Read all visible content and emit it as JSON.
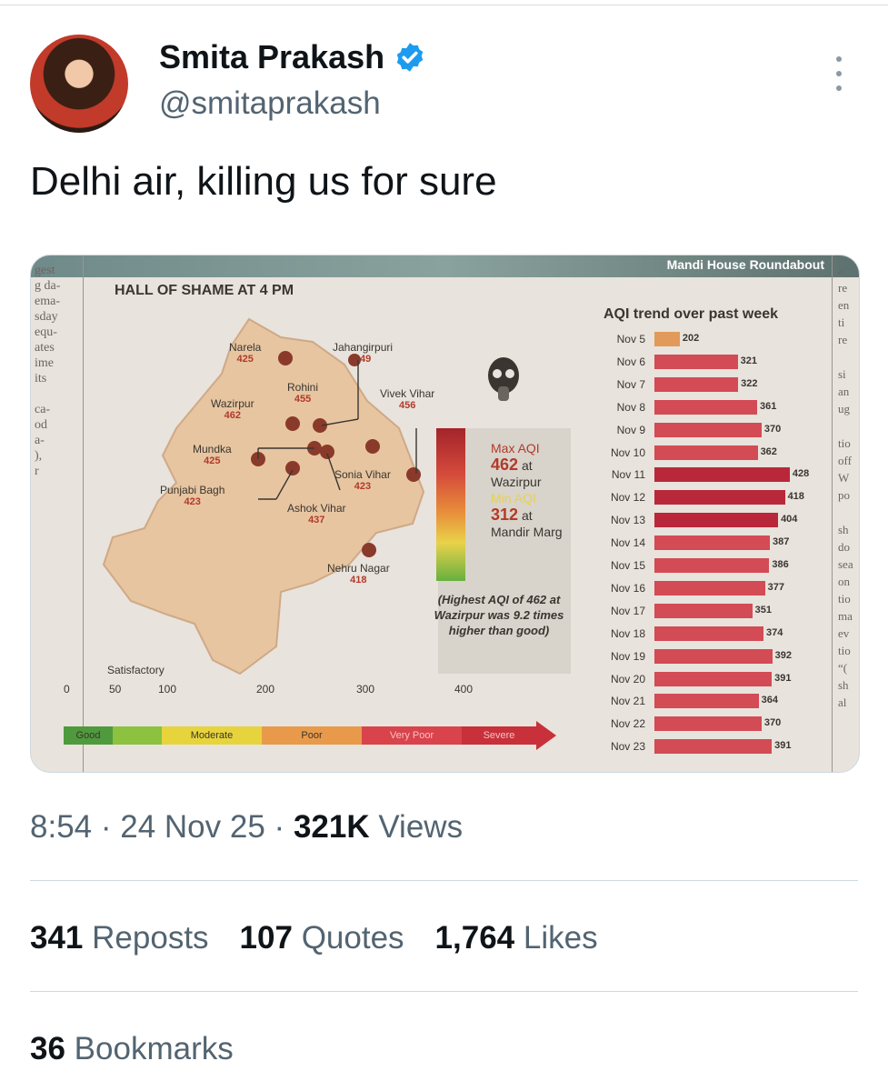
{
  "author": {
    "name": "Smita Prakash",
    "handle": "@smitaprakash",
    "verified": true,
    "verified_color": "#1d9bf0"
  },
  "tweet": {
    "text": "Delhi air, killing us for sure",
    "time": "8:54",
    "date": "24 Nov 25",
    "separator": "·",
    "views_count": "321K",
    "views_label": "Views"
  },
  "stats": {
    "reposts_count": "341",
    "reposts_label": "Reposts",
    "quotes_count": "107",
    "quotes_label": "Quotes",
    "likes_count": "1,764",
    "likes_label": "Likes",
    "bookmarks_count": "36",
    "bookmarks_label": "Bookmarks"
  },
  "icons": {
    "more": "more-vertical-icon",
    "verified": "verified-badge-icon"
  },
  "image": {
    "top_caption": "Mandi House Roundabout",
    "panel_title": "HALL OF SHAME AT 4 PM",
    "locations": [
      {
        "name": "Narela",
        "aqi": "425"
      },
      {
        "name": "Jahangirpuri",
        "aqi": "449"
      },
      {
        "name": "Rohini",
        "aqi": "455"
      },
      {
        "name": "Wazirpur",
        "aqi": "462"
      },
      {
        "name": "Vivek Vihar",
        "aqi": "456"
      },
      {
        "name": "Mundka",
        "aqi": "425"
      },
      {
        "name": "Sonia Vihar",
        "aqi": "423"
      },
      {
        "name": "Punjabi Bagh",
        "aqi": "423"
      },
      {
        "name": "Ashok Vihar",
        "aqi": "437"
      },
      {
        "name": "Nehru Nagar",
        "aqi": "418"
      }
    ],
    "max_label": "Max AQI",
    "max_value": "462",
    "max_at": "at",
    "max_place": "Wazirpur",
    "min_label": "Min AQI",
    "min_value": "312",
    "min_at": "at",
    "min_place": "Mandir Marg",
    "note": "(Highest AQI of 462 at Wazirpur was 9.2 times higher than good)",
    "scale_label_satisfactory": "Satisfactory",
    "scale_ticks": [
      "0",
      "50",
      "100",
      "200",
      "300",
      "400"
    ],
    "scale_bands": [
      {
        "label": "Good",
        "color": "#4f9a3c"
      },
      {
        "label": "",
        "color": "#8cc23f"
      },
      {
        "label": "Moderate",
        "color": "#e7d43c"
      },
      {
        "label": "Poor",
        "color": "#e89a4a"
      },
      {
        "label": "Very Poor",
        "color": "#d9434b"
      },
      {
        "label": "Severe",
        "color": "#c8303a"
      }
    ],
    "chart_data": {
      "type": "bar",
      "title": "AQI trend over past week",
      "categories": [
        "Nov 5",
        "Nov 6",
        "Nov 7",
        "Nov 8",
        "Nov 9",
        "Nov 10",
        "Nov 11",
        "Nov 12",
        "Nov 13",
        "Nov 14",
        "Nov 15",
        "Nov 16",
        "Nov 17",
        "Nov 18",
        "Nov 19",
        "Nov 20",
        "Nov 21",
        "Nov 22",
        "Nov 23"
      ],
      "values": [
        202,
        321,
        322,
        361,
        370,
        362,
        428,
        418,
        404,
        387,
        386,
        377,
        351,
        374,
        392,
        391,
        364,
        370,
        391
      ],
      "orientation": "horizontal",
      "colors": {
        "first": "#e29a5a",
        "high": "#b8283a",
        "normal": "#d24b55"
      }
    },
    "side_text_left": [
      "gest",
      "g da-",
      "ema-",
      "sday",
      "equ-",
      "ates",
      "ime",
      "its",
      "",
      "ca-",
      "od",
      "a-",
      "),",
      "r"
    ],
    "side_text_right": [
      "a",
      "re",
      "en",
      "ti",
      "re",
      "",
      "si",
      "an",
      "ug",
      "",
      "tio",
      "off",
      "W",
      "po",
      "",
      "sh",
      "do",
      "sea",
      "on",
      "tio",
      "ma",
      "ev",
      "tio",
      "“(",
      "sh",
      "al"
    ]
  }
}
